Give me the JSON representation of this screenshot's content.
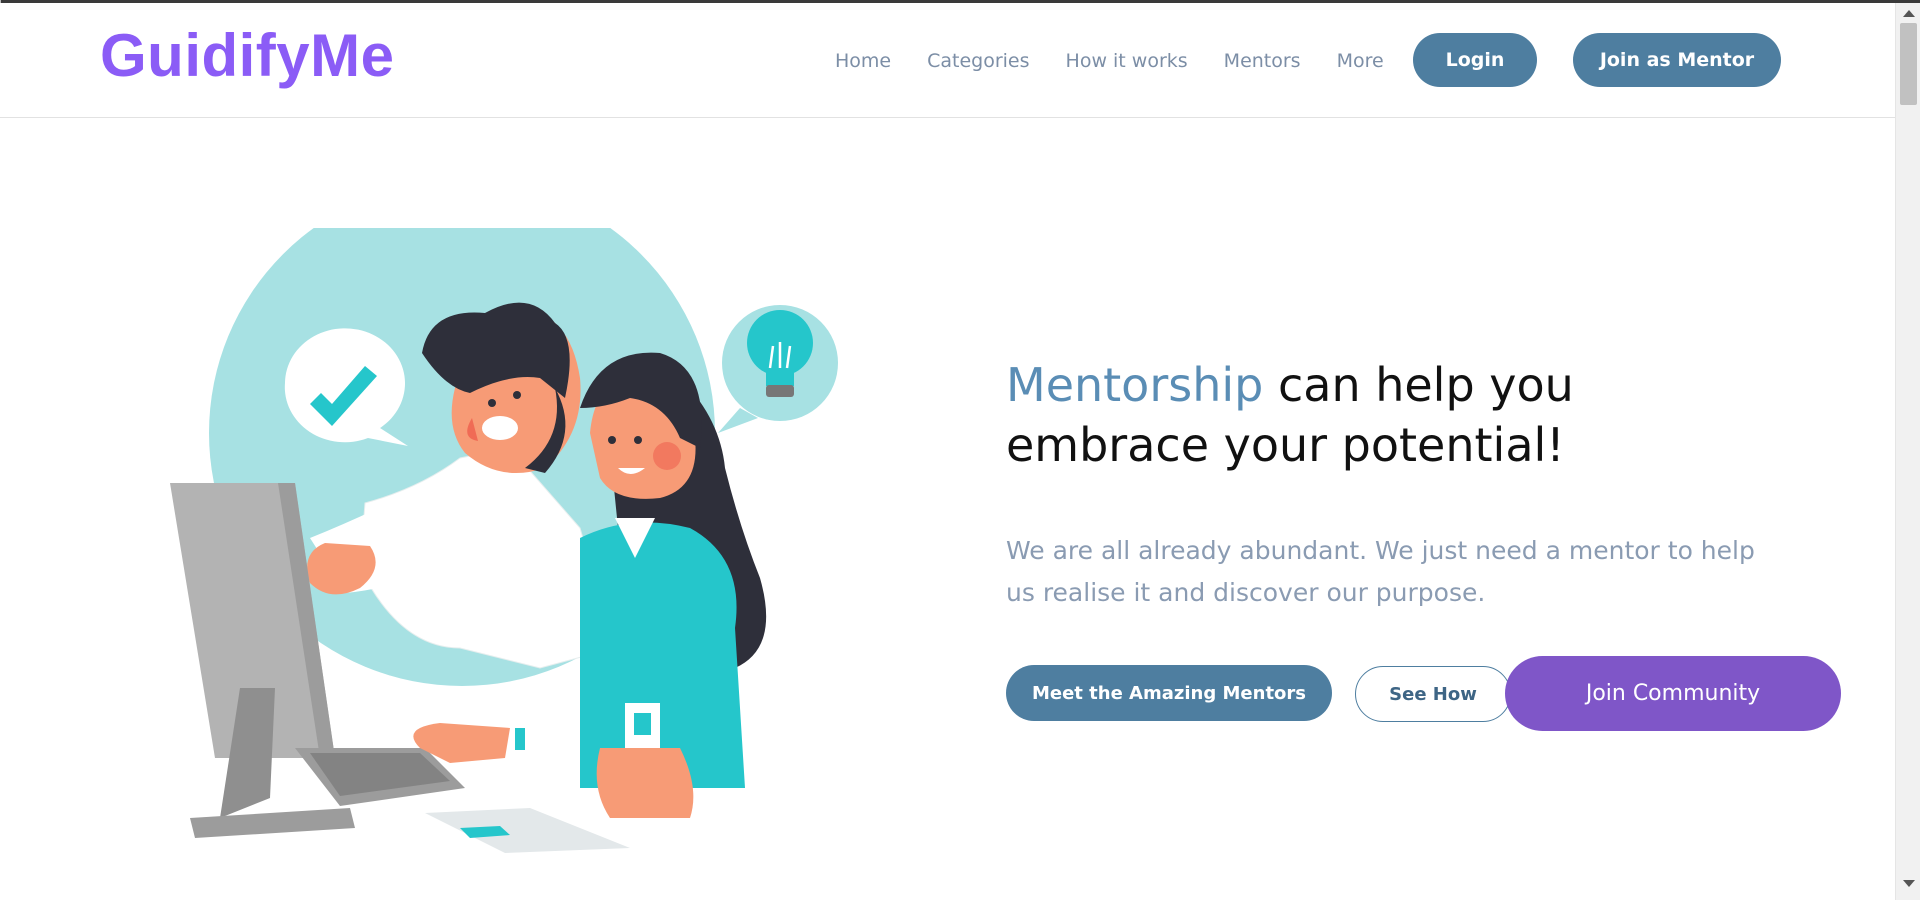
{
  "brand": {
    "logo_text": "GuidifyMe",
    "logo_color": "#8b5cf6"
  },
  "nav": {
    "items": [
      {
        "label": "Home"
      },
      {
        "label": "Categories"
      },
      {
        "label": "How it works"
      },
      {
        "label": "Mentors"
      },
      {
        "label": "More"
      }
    ],
    "login_label": "Login",
    "join_mentor_label": "Join as Mentor"
  },
  "hero": {
    "headline_accent": "Mentorship",
    "headline_rest_1": " can help you",
    "headline_rest_2": "embrace your potential!",
    "subtext": "We are all already abundant. We just need a mentor to help us realise it and discover our purpose.",
    "cta_mentors": "Meet the Amazing Mentors",
    "cta_seehow": "See How",
    "cta_community": "Join Community",
    "illustration": {
      "icons": [
        "checkmark-icon",
        "lightbulb-icon"
      ]
    }
  },
  "colors": {
    "primary": "#4e7ea0",
    "accent_text": "#5a8db5",
    "community": "#7f56c8",
    "teal": "#25c6cb",
    "teal_light": "#a7e1e3"
  }
}
